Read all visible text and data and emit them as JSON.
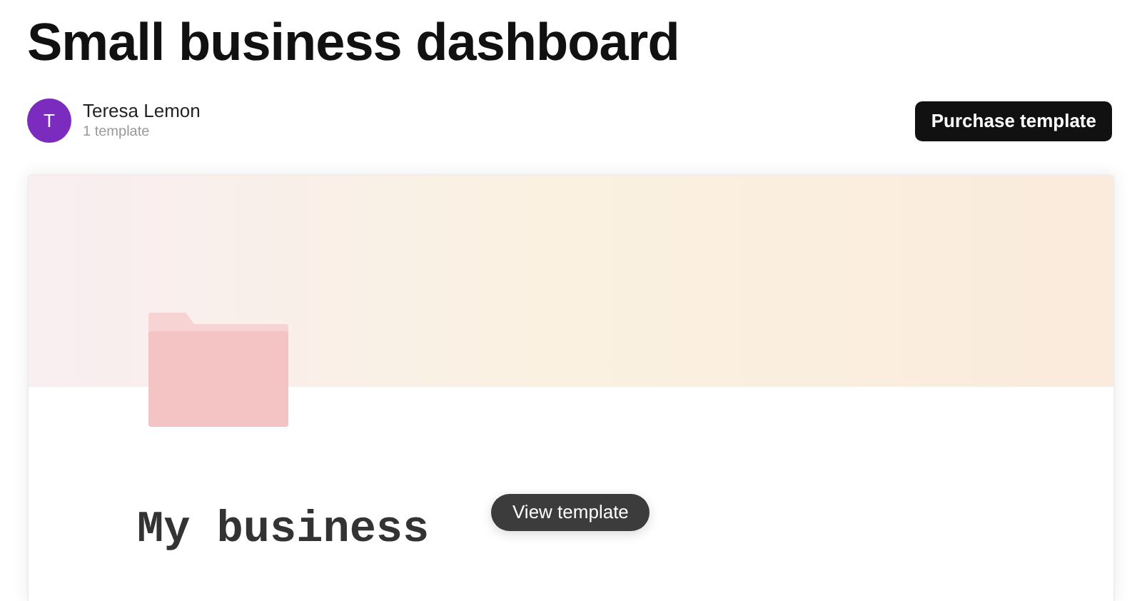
{
  "title": "Small business dashboard",
  "author": {
    "initial": "T",
    "name": "Teresa Lemon",
    "count": "1 template"
  },
  "purchase_button": "Purchase template",
  "preview": {
    "page_title": "My business",
    "view_button": "View template"
  }
}
